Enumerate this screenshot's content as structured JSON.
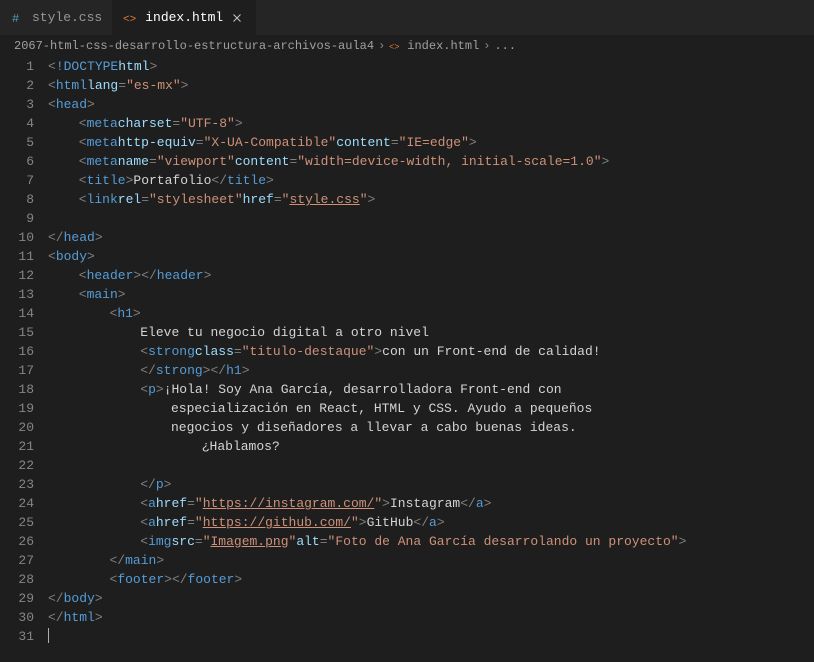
{
  "tabs": [
    {
      "label": "style.css",
      "type": "css",
      "active": false
    },
    {
      "label": "index.html",
      "type": "html",
      "active": true
    }
  ],
  "breadcrumb": {
    "folder": "2067-html-css-desarrollo-estructura-archivos-aula4",
    "file": "index.html",
    "extra": "..."
  },
  "lines": {
    "count": 31,
    "l1_doctype": "!DOCTYPE",
    "l1_html": "html",
    "l2_tag": "html",
    "l2_attr": "lang",
    "l2_val": "\"es-mx\"",
    "l3_tag": "head",
    "l4_tag": "meta",
    "l4_attr": "charset",
    "l4_val": "\"UTF-8\"",
    "l5_tag": "meta",
    "l5_attr1": "http-equiv",
    "l5_val1": "\"X-UA-Compatible\"",
    "l5_attr2": "content",
    "l5_val2": "\"IE=edge\"",
    "l6_tag": "meta",
    "l6_attr1": "name",
    "l6_val1": "\"viewport\"",
    "l6_attr2": "content",
    "l6_val2": "\"width=device-width, initial-scale=1.0\"",
    "l7_tag": "title",
    "l7_text": "Portafolio",
    "l8_tag": "link",
    "l8_attr1": "rel",
    "l8_val1": "\"stylesheet\"",
    "l8_attr2": "href",
    "l8_val2": "\"style.css\"",
    "l8_link_inner": "style.css",
    "l10_tag": "head",
    "l11_tag": "body",
    "l12_tag": "header",
    "l13_tag": "main",
    "l14_tag": "h1",
    "l15_text": "Eleve tu negocio digital a otro nivel",
    "l16_tag": "strong",
    "l16_attr": "class",
    "l16_val": "\"titulo-destaque\"",
    "l16_text": "con un Front-end de calidad!",
    "l17_tag1": "strong",
    "l17_tag2": "h1",
    "l18_tag": "p",
    "l18_text": "¡Hola! Soy Ana García, desarrolladora Front-end con ",
    "l19_text": "especialización en React, HTML y CSS. Ayudo a pequeños ",
    "l20_text": "negocios y diseñadores a llevar a cabo buenas ideas. ",
    "l21_text": "¿Hablamos?",
    "l23_tag": "p",
    "l24_tag": "a",
    "l24_attr": "href",
    "l24_link": "https://instagram.com/",
    "l24_text": "Instagram",
    "l25_tag": "a",
    "l25_attr": "href",
    "l25_link": "https://github.com/",
    "l25_text": "GitHub",
    "l26_tag": "img",
    "l26_attr1": "src",
    "l26_link": "Imagem.png",
    "l26_attr2": "alt",
    "l26_val2": "\"Foto de Ana García desarrolando un proyecto\"",
    "l27_tag": "main",
    "l28_tag": "footer",
    "l29_tag": "body",
    "l30_tag": "html"
  }
}
